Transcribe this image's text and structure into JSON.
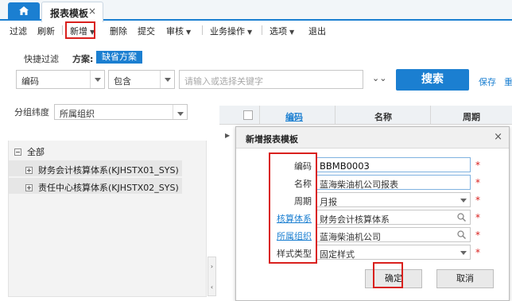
{
  "tabs": {
    "active_label": "报表模板",
    "close_glyph": "×"
  },
  "toolbar": {
    "items": [
      {
        "label": "过滤"
      },
      {
        "label": "刷新"
      },
      {
        "label": "新增"
      },
      {
        "label": "删除"
      },
      {
        "label": "提交"
      },
      {
        "label": "审核"
      },
      {
        "label": "业务操作"
      },
      {
        "label": "选项"
      },
      {
        "label": "退出"
      }
    ]
  },
  "quick_filter": {
    "label": "快捷过滤",
    "scheme_label": "方案:",
    "scheme_value": "缺省方案",
    "field_select": "编码",
    "operator_select": "包含",
    "keyword_placeholder": "请输入或选择关键字",
    "search_label": "搜索",
    "save_label": "保存",
    "reset_label": "重"
  },
  "group_dimension": {
    "label": "分组纬度",
    "value": "所属组织"
  },
  "tree": {
    "root": "全部",
    "children": [
      "财务会计核算体系(KJHSTX01_SYS)",
      "责任中心核算体系(KJHSTX02_SYS)"
    ]
  },
  "grid": {
    "columns": [
      "编码",
      "名称",
      "周期"
    ]
  },
  "modal": {
    "title": "新增报表模板",
    "close_glyph": "×",
    "fields": [
      {
        "label": "编码",
        "value": "BBMB0003"
      },
      {
        "label": "名称",
        "value": "蓝海柴油机公司报表"
      },
      {
        "label": "周期",
        "value": "月报"
      },
      {
        "label": "核算体系",
        "value": "财务会计核算体系"
      },
      {
        "label": "所属组织",
        "value": "蓝海柴油机公司"
      },
      {
        "label": "样式类型",
        "value": "固定样式"
      }
    ],
    "required_mark": "*",
    "ok_label": "确定",
    "cancel_label": "取消"
  },
  "colors": {
    "accent": "#1b7fd1",
    "highlight": "#d9201d",
    "required": "#d9201d"
  }
}
